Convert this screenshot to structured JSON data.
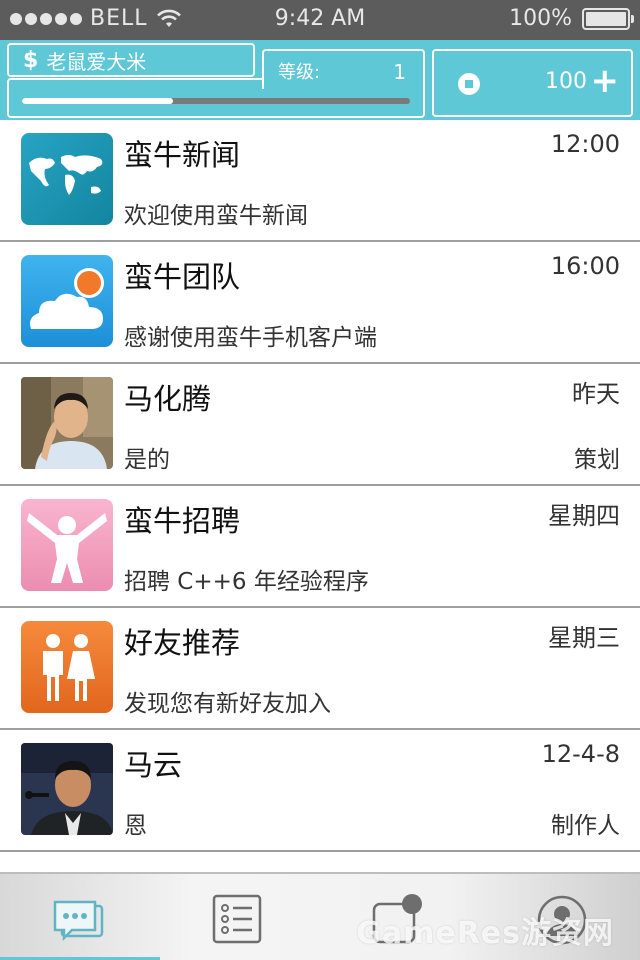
{
  "status_bar": {
    "carrier": "BELL",
    "time": "9:42 AM",
    "battery_text": "100%"
  },
  "header": {
    "username": "老鼠爱大米",
    "currency_symbol": "$",
    "level_label": "等级:",
    "level_value": "1",
    "progress_fraction": 0.39,
    "coins": "100",
    "add_symbol": "+"
  },
  "colors": {
    "accent": "#5fc8d6",
    "status_bar_bg": "#5c5c5c"
  },
  "conversations": [
    {
      "name": "蛮牛新闻",
      "time": "12:00",
      "preview": "欢迎使用蛮牛新闻",
      "tag": "",
      "avatar_icon": "world-map-icon"
    },
    {
      "name": "蛮牛团队",
      "time": "16:00",
      "preview": "感谢使用蛮牛手机客户端",
      "tag": "",
      "avatar_icon": "cloud-sun-icon"
    },
    {
      "name": "马化腾",
      "time": "昨天",
      "preview": "是的",
      "tag": "策划",
      "avatar_icon": "person-photo"
    },
    {
      "name": "蛮牛招聘",
      "time": "星期四",
      "preview": "招聘 C++6 年经验程序",
      "tag": "",
      "avatar_icon": "cheering-person-icon"
    },
    {
      "name": "好友推荐",
      "time": "星期三",
      "preview": "发现您有新好友加入",
      "tag": "",
      "avatar_icon": "man-woman-icon"
    },
    {
      "name": "马云",
      "time": "12-4-8",
      "preview": "恩",
      "tag": "制作人",
      "avatar_icon": "person-photo"
    }
  ],
  "tabbar": {
    "tabs": [
      {
        "icon": "chat-bubble-icon",
        "active": true
      },
      {
        "icon": "list-icon",
        "active": false
      },
      {
        "icon": "notification-icon",
        "active": false
      },
      {
        "icon": "profile-icon",
        "active": false
      }
    ],
    "watermark": "GameRes游资网"
  }
}
